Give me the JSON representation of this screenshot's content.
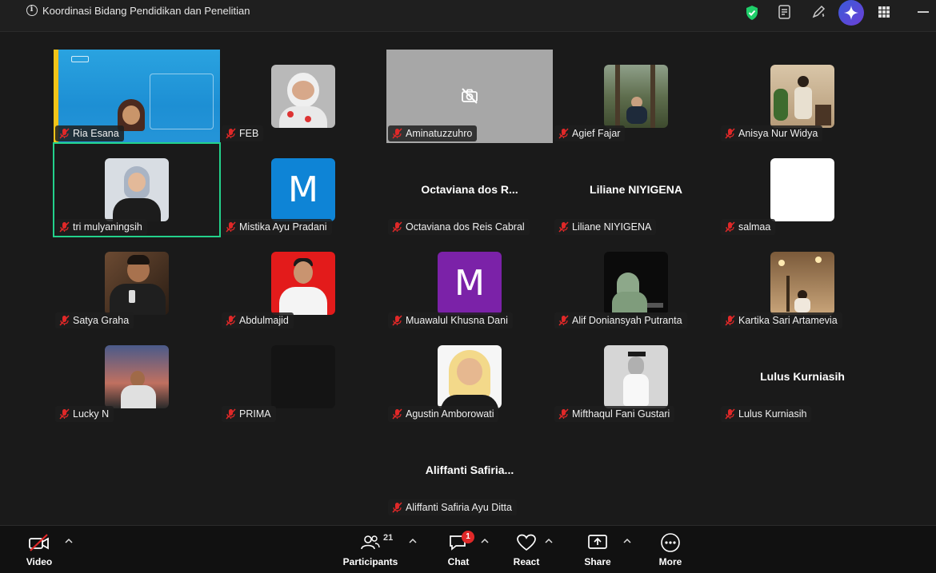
{
  "window": {
    "title": "Koordinasi Bidang Pendidikan dan Penelitian"
  },
  "icons": {
    "info": "info-icon",
    "security": "shield-check-icon",
    "notes": "notes-icon",
    "annotate": "pen-icon",
    "ai": "sparkle-icon",
    "apps": "grid-icon",
    "minimize": "minimize-icon",
    "muted": "mic-muted-icon",
    "camera_off": "camera-off-icon"
  },
  "colors": {
    "active_speaker": "#23d18b",
    "muted": "#e02828",
    "badge": "#e02828"
  },
  "participants": [
    {
      "name": "Ria Esana"
    },
    {
      "name": "FEB"
    },
    {
      "name": "Aminatuzzuhro"
    },
    {
      "name": "Agief Fajar"
    },
    {
      "name": "Anisya Nur Widya"
    },
    {
      "name": "tri mulyaningsih"
    },
    {
      "name": "Mistika Ayu Pradani",
      "initial": "M"
    },
    {
      "name": "Octaviana dos Reis Cabral",
      "display": "Octaviana  dos  R..."
    },
    {
      "name": "Liliane NIYIGENA",
      "display": "Liliane NIYIGENA"
    },
    {
      "name": "salmaa"
    },
    {
      "name": "Satya Graha"
    },
    {
      "name": "Abdulmajid"
    },
    {
      "name": "Muawalul Khusna Dani",
      "initial": "M"
    },
    {
      "name": "Alif Doniansyah Putranta"
    },
    {
      "name": "Kartika Sari Artamevia"
    },
    {
      "name": "Lucky N"
    },
    {
      "name": "PRIMA"
    },
    {
      "name": "Agustin Amborowati"
    },
    {
      "name": "Mifthaqul Fani Gustari"
    },
    {
      "name": "Lulus Kurniasih",
      "display": "Lulus Kurniasih"
    },
    {
      "name": "Aliffanti Safiria Ayu Ditta",
      "display": "Aliffanti  Safiria..."
    }
  ],
  "toolbar": {
    "video": "Video",
    "participants": "Participants",
    "participants_count": "21",
    "chat": "Chat",
    "chat_badge": "1",
    "react": "React",
    "share": "Share",
    "more": "More"
  }
}
